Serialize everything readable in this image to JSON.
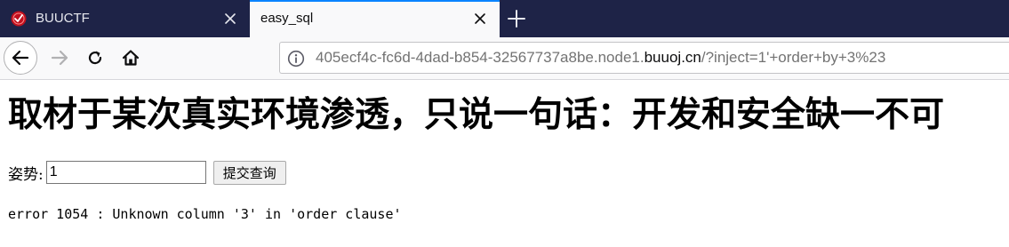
{
  "browser": {
    "tabs": [
      {
        "title": "BUUCTF",
        "icon": "buuctf-logo-icon",
        "active": false
      },
      {
        "title": "easy_sql",
        "active": true
      }
    ],
    "new_tab_icon": "plus-icon",
    "address": {
      "prefix": "405ecf4c-fc6d-4dad-b854-32567737a8be.node1.",
      "domain": "buuoj.cn",
      "suffix": "/?inject=1'+order+by+3%23"
    },
    "colors": {
      "tab_strip": "#1e2347",
      "active_tab_accent": "#0a84ff",
      "favicon_red": "#c0101e"
    }
  },
  "page": {
    "title": "取材于某次真实环境渗透，只说一句话：开发和安全缺一不可",
    "form": {
      "label": "姿势:",
      "input_value": "1",
      "submit_label": "提交查询"
    },
    "error": "error 1054 : Unknown column '3' in 'order clause'"
  }
}
